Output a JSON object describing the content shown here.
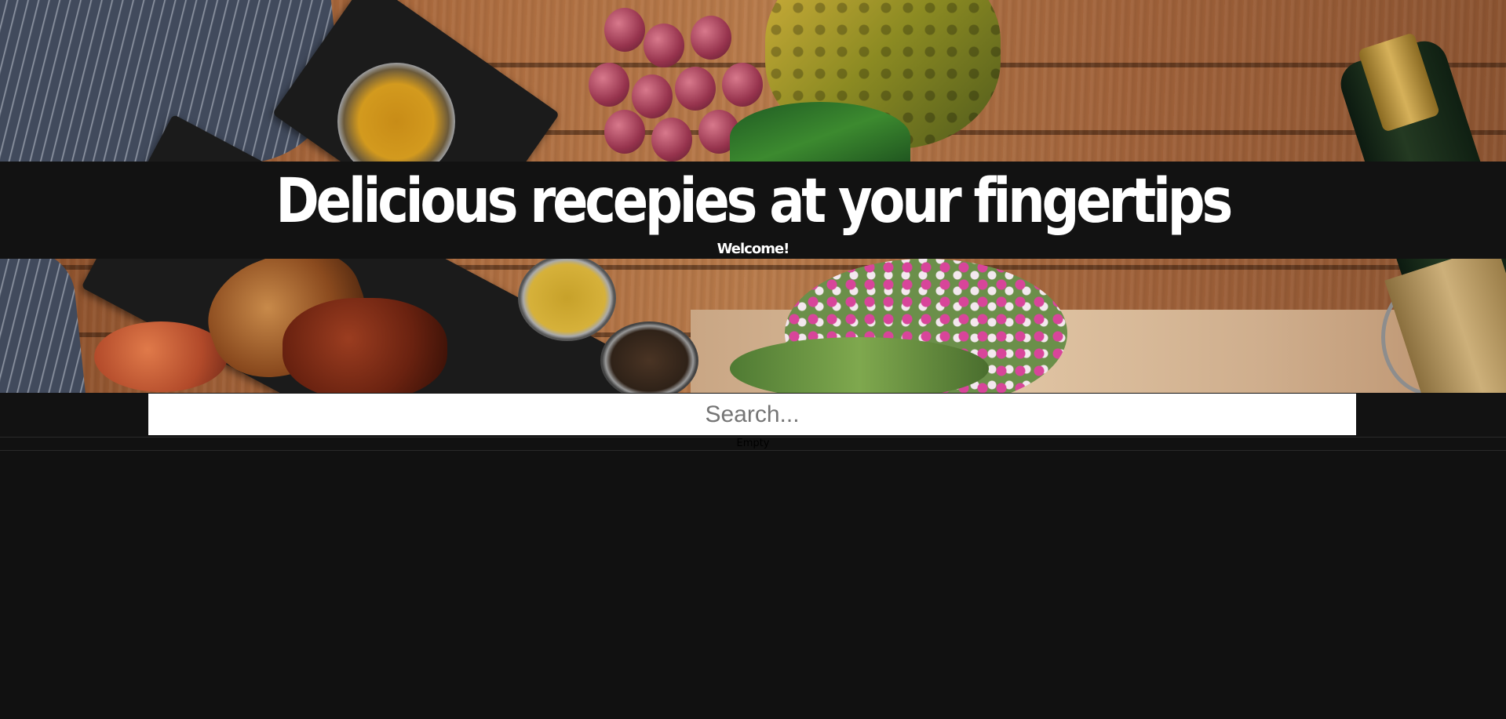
{
  "header": {
    "title": "Delicious recepies at your fingertips",
    "subtitle": "Welcome!"
  },
  "search": {
    "placeholder": "Search..."
  },
  "results": {
    "empty_text": "Empty"
  },
  "colors": {
    "page_background": "#111111",
    "title_bar": "#121212",
    "title_text": "#ffffff",
    "search_background": "#ffffff"
  }
}
